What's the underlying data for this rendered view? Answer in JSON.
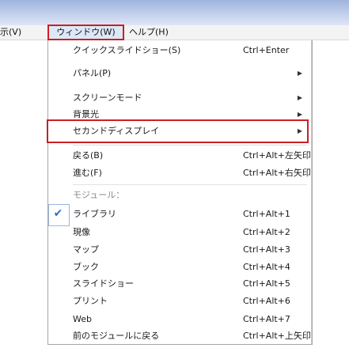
{
  "menubar": {
    "view": "示(V)",
    "window": "ウィンドウ(W)",
    "help": "ヘルプ(H)"
  },
  "menu": {
    "items": [
      {
        "label": "クイックスライドショー(S)",
        "shortcut": "Ctrl+Enter",
        "submenu": false
      },
      {
        "label": "パネル(P)",
        "shortcut": "",
        "submenu": true
      },
      {
        "label": "スクリーンモード",
        "shortcut": "",
        "submenu": true
      },
      {
        "label": "背景光",
        "shortcut": "",
        "submenu": true
      },
      {
        "label": "セカンドディスプレイ",
        "shortcut": "",
        "submenu": true
      },
      {
        "label": "戻る(B)",
        "shortcut": "Ctrl+Alt+左矢印",
        "submenu": false
      },
      {
        "label": "進む(F)",
        "shortcut": "Ctrl+Alt+右矢印",
        "submenu": false
      }
    ],
    "section_header": "モジュール：",
    "modules": [
      {
        "label": "ライブラリ",
        "shortcut": "Ctrl+Alt+1",
        "checked": true
      },
      {
        "label": "現像",
        "shortcut": "Ctrl+Alt+2",
        "checked": false
      },
      {
        "label": "マップ",
        "shortcut": "Ctrl+Alt+3",
        "checked": false
      },
      {
        "label": "ブック",
        "shortcut": "Ctrl+Alt+4",
        "checked": false
      },
      {
        "label": "スライドショー",
        "shortcut": "Ctrl+Alt+5",
        "checked": false
      },
      {
        "label": "プリント",
        "shortcut": "Ctrl+Alt+6",
        "checked": false
      },
      {
        "label": "Web",
        "shortcut": "Ctrl+Alt+7",
        "checked": false
      }
    ],
    "back_to_previous": {
      "label": "前のモジュールに戻る",
      "shortcut": "Ctrl+Alt+上矢印"
    }
  },
  "colors": {
    "highlight_border": "#cc1e24",
    "check": "#2f6fd1"
  }
}
